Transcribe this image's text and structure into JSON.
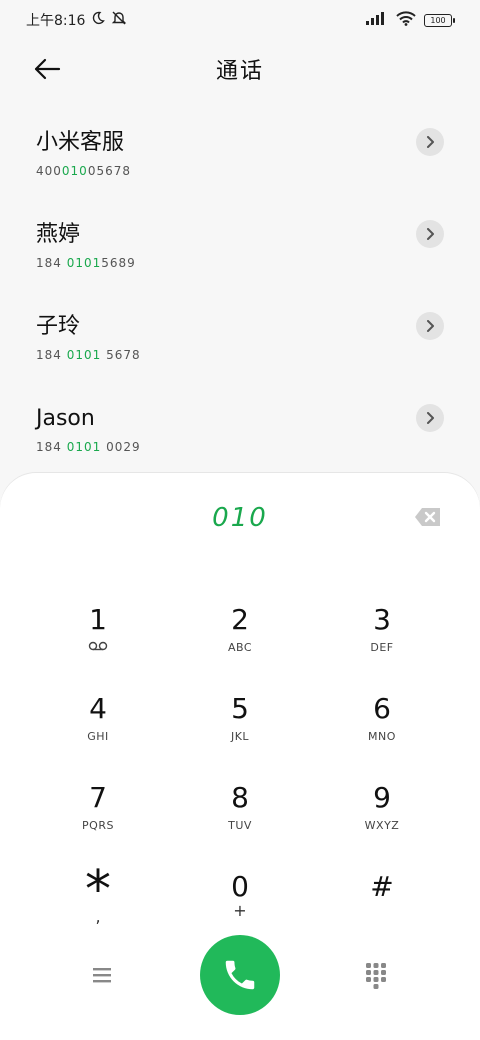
{
  "status": {
    "time": "上午8:16",
    "battery": "100"
  },
  "header": {
    "title": "通话"
  },
  "contacts": [
    {
      "name": "小米客服",
      "number_pre": "400",
      "number_hl": "010",
      "number_post": "05678"
    },
    {
      "name": "燕婷",
      "number_pre": "184 ",
      "number_hl": "0101",
      "number_post": "5689"
    },
    {
      "name": "子玲",
      "number_pre": "184 ",
      "number_hl": "0101",
      "number_post": " 5678"
    },
    {
      "name": "Jason",
      "number_pre": "184 ",
      "number_hl": "0101",
      "number_post": " 0029"
    }
  ],
  "dialer": {
    "input": "010",
    "keys": [
      {
        "digit": "1",
        "letters": ""
      },
      {
        "digit": "2",
        "letters": "ABC"
      },
      {
        "digit": "3",
        "letters": "DEF"
      },
      {
        "digit": "4",
        "letters": "GHI"
      },
      {
        "digit": "5",
        "letters": "JKL"
      },
      {
        "digit": "6",
        "letters": "MNO"
      },
      {
        "digit": "7",
        "letters": "PQRS"
      },
      {
        "digit": "8",
        "letters": "TUV"
      },
      {
        "digit": "9",
        "letters": "WXYZ"
      },
      {
        "digit": "*",
        "letters": ","
      },
      {
        "digit": "0",
        "letters": "+"
      },
      {
        "digit": "#",
        "letters": ""
      }
    ]
  },
  "colors": {
    "accent": "#1aa84d",
    "call": "#21b95a"
  }
}
